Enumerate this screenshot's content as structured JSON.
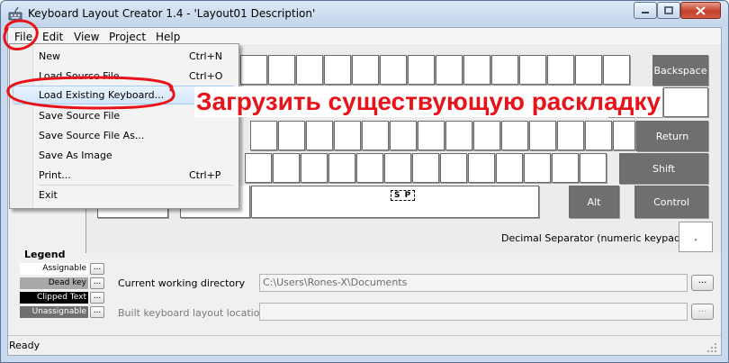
{
  "window": {
    "title": "Keyboard Layout Creator 1.4 - 'Layout01 Description'",
    "icon": "keyboard-app-icon",
    "controls": {
      "minimize": "minimize-icon",
      "maximize": "maximize-icon",
      "close": "close-icon"
    }
  },
  "menubar": {
    "items": [
      {
        "label": "File"
      },
      {
        "label": "Edit"
      },
      {
        "label": "View"
      },
      {
        "label": "Project"
      },
      {
        "label": "Help"
      }
    ]
  },
  "file_menu": {
    "items": [
      {
        "label": "New",
        "shortcut": "Ctrl+N"
      },
      {
        "label": "Load Source File...",
        "shortcut": "Ctrl+O"
      },
      {
        "label": "Load Existing Keyboard...",
        "shortcut": ""
      },
      {
        "label": "Save Source File",
        "shortcut": ""
      },
      {
        "label": "Save Source File As...",
        "shortcut": ""
      },
      {
        "label": "Save As Image",
        "shortcut": ""
      },
      {
        "label": "Print...",
        "shortcut": "Ctrl+P"
      },
      {
        "label": "Exit",
        "shortcut": ""
      }
    ]
  },
  "annotation": {
    "caption": "Загрузить существующую раскладку",
    "color": "#e8131a"
  },
  "keyboard": {
    "backspace": "Backspace",
    "return": "Return",
    "shift": "Shift",
    "alt": "Alt",
    "control": "Control",
    "space": "S P",
    "decimal_label": "Decimal Separator (numeric keypad)",
    "decimal_value": "."
  },
  "legend": {
    "title": "Legend",
    "items": [
      {
        "label": "Assignable",
        "color": "#ffffff",
        "text_color": "#000000"
      },
      {
        "label": "Dead key",
        "color": "#a9a9a9",
        "text_color": "#000000"
      },
      {
        "label": "Clipped Text",
        "color": "#000000",
        "text_color": "#ffffff"
      },
      {
        "label": "Unassignable",
        "color": "#6f6f6f",
        "text_color": "#ffffff"
      }
    ],
    "button_label": "..."
  },
  "fields": {
    "cwd_label": "Current working directory",
    "cwd_value": "C:\\Users\\Rones-X\\Documents",
    "built_label": "Built keyboard layout location",
    "built_value": "",
    "browse_label": "..."
  },
  "status": {
    "text": "Ready"
  }
}
